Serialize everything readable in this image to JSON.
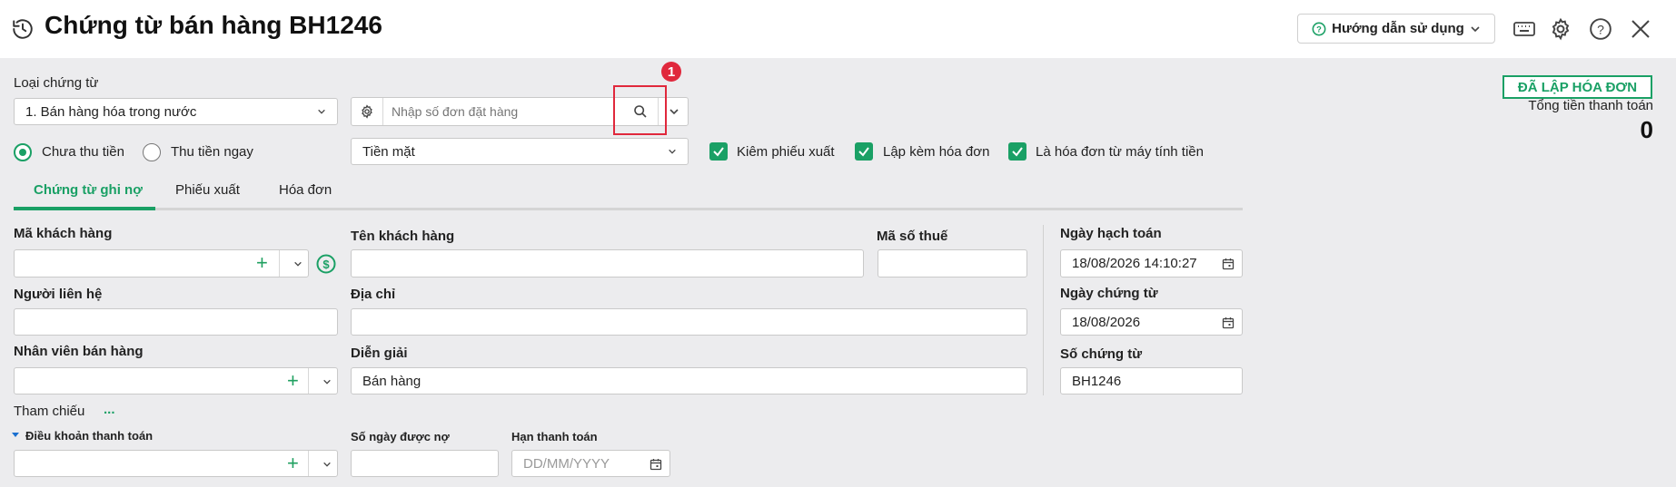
{
  "header": {
    "title": "Chứng từ bán hàng BH1246",
    "help_label": "Hướng dẫn sử dụng"
  },
  "form": {
    "voucher_type_label": "Loại chứng từ",
    "voucher_type_value": "1. Bán hàng hóa trong nước",
    "order_search_placeholder": "Nhập số đơn đặt hàng",
    "payment_options": [
      "Chưa thu tiền",
      "Thu tiền ngay"
    ],
    "payment_selected": "Chưa thu tiền",
    "payment_method_value": "Tiền mặt",
    "checkboxes": [
      {
        "label": "Kiêm phiếu xuất",
        "checked": true
      },
      {
        "label": "Lập kèm hóa đơn",
        "checked": true
      },
      {
        "label": "Là hóa đơn từ máy tính tiền",
        "checked": true
      }
    ]
  },
  "status": {
    "badge": "ĐÃ LẬP HÓA ĐƠN",
    "total_label": "Tổng tiền thanh toán",
    "total_value": "0"
  },
  "tabs": [
    {
      "label": "Chứng từ ghi nợ",
      "active": true
    },
    {
      "label": "Phiếu xuất",
      "active": false
    },
    {
      "label": "Hóa đơn",
      "active": false
    }
  ],
  "fields": {
    "customer_code_label": "Mã khách hàng",
    "customer_name_label": "Tên khách hàng",
    "tax_code_label": "Mã số thuế",
    "contact_label": "Người liên hệ",
    "address_label": "Địa chỉ",
    "salesperson_label": "Nhân viên bán hàng",
    "description_label": "Diễn giải",
    "description_value": "Bán hàng",
    "reference_label": "Tham chiếu",
    "reference_more": "...",
    "payment_terms_label": "Điều khoản thanh toán",
    "credit_days_label": "Số ngày được nợ",
    "due_date_label": "Hạn thanh toán",
    "due_date_placeholder": "DD/MM/YYYY",
    "posting_date_label": "Ngày hạch toán",
    "posting_date_value": "18/08/2026 14:10:27",
    "voucher_date_label": "Ngày chứng từ",
    "voucher_date_value": "18/08/2026",
    "voucher_no_label": "Số chứng từ",
    "voucher_no_value": "BH1246"
  },
  "annotation": {
    "step_number": "1",
    "color": "#e0283c"
  },
  "colors": {
    "accent": "#1aa065",
    "highlight": "#e0283c"
  }
}
